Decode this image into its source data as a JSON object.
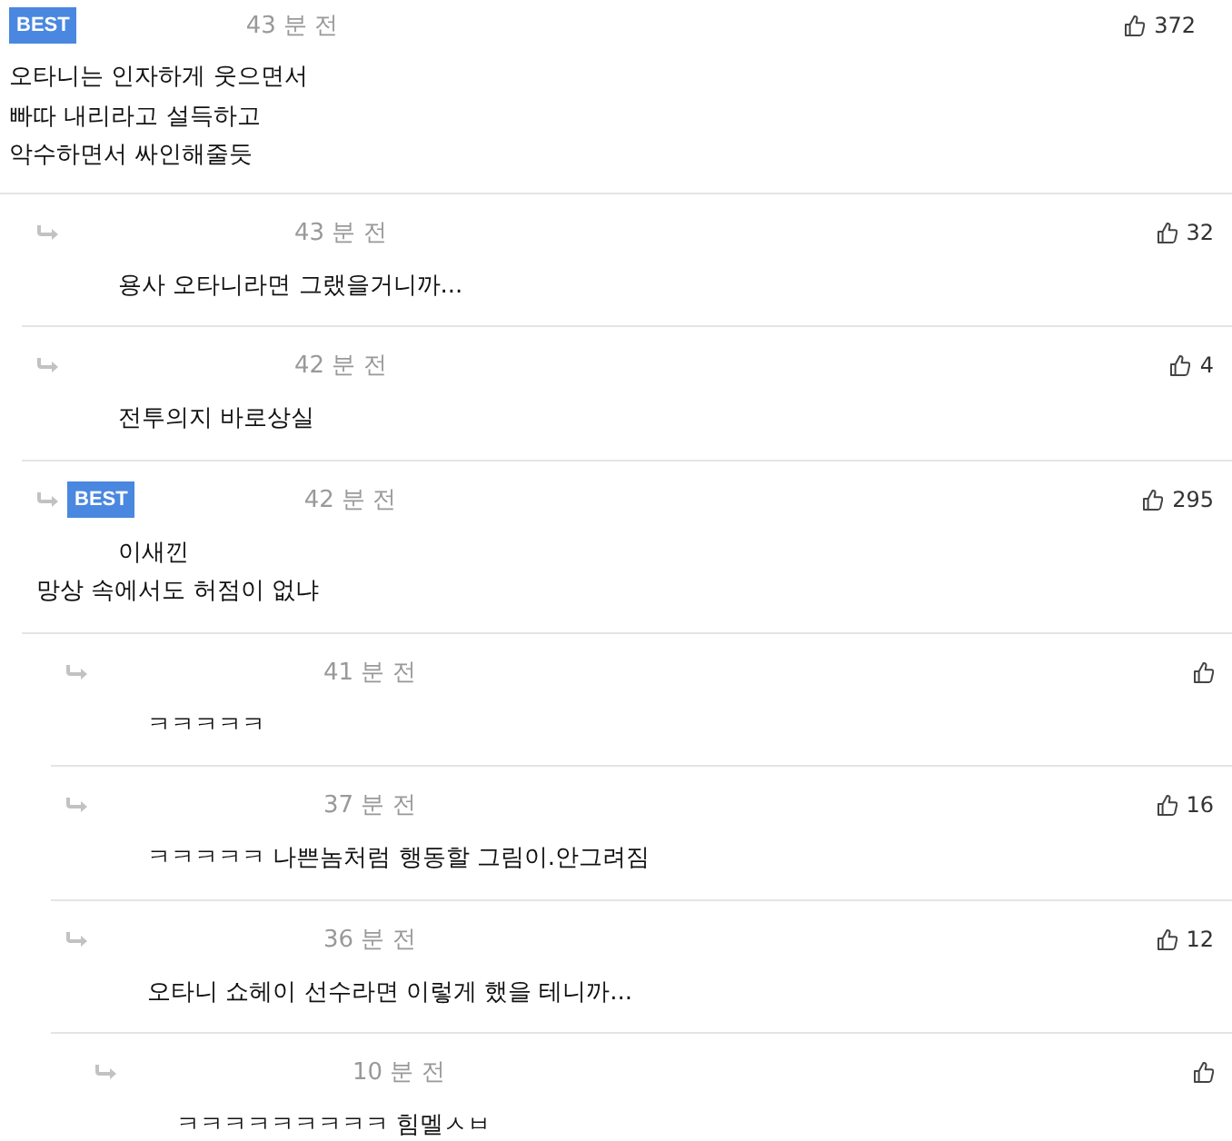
{
  "comments": [
    {
      "badge": "BEST",
      "time": "43 분 전",
      "likes": "372",
      "body": "오타니는 인자하게 웃으면서\n빠따 내리라고 설득하고\n악수하면서 싸인해줄듯",
      "children": [
        {
          "time": "43 분 전",
          "likes": "32",
          "body": "용사 오타니라면 그랬을거니까..."
        },
        {
          "time": "42 분 전",
          "likes": "4",
          "body": "전투의지 바로상실"
        },
        {
          "badge": "BEST",
          "time": "42 분 전",
          "likes": "295",
          "body": "이새낀\n망상 속에서도 허점이 없냐",
          "children": [
            {
              "time": "41 분 전",
              "body": "ㅋㅋㅋㅋㅋ"
            },
            {
              "time": "37 분 전",
              "likes": "16",
              "body": "ㅋㅋㅋㅋㅋ 나쁜놈처럼 행동할 그림이.안그려짐"
            },
            {
              "time": "36 분 전",
              "likes": "12",
              "body": "오타니 쇼헤이 선수라면 이렇게 했을 테니까...",
              "children": [
                {
                  "time": "10 분 전",
                  "body": "ㅋㅋㅋㅋㅋㅋㅋㅋㅋ 힘멜ㅅㅂ"
                }
              ]
            }
          ]
        }
      ]
    }
  ]
}
